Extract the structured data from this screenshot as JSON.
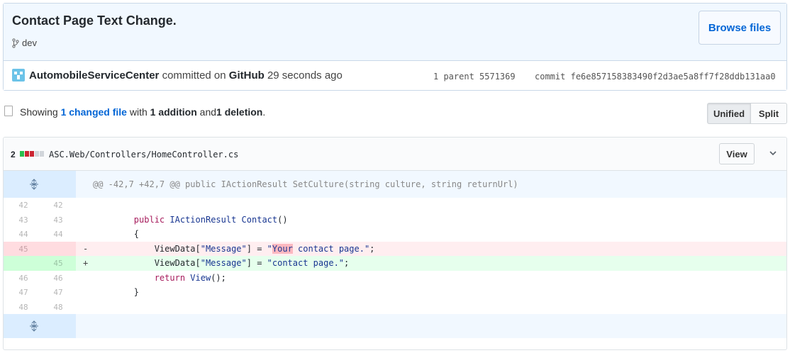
{
  "commit": {
    "title": "Contact Page Text Change.",
    "branch": "dev",
    "browse_files": "Browse files",
    "author": "AutomobileServiceCenter",
    "committed_on": "committed on",
    "platform": "GitHub",
    "time_ago": "29 seconds ago",
    "parent_label": "1 parent",
    "parent_sha": "5571369",
    "commit_label": "commit",
    "commit_sha": "fe6e857158383490f2d3ae5a8ff7f28ddb131aa0"
  },
  "summary": {
    "prefix": "Showing",
    "changed_files": "1 changed file",
    "with": "with",
    "additions": "1 addition",
    "and": "and",
    "deletions": "1 deletion",
    "suffix": ".",
    "unified_label": "Unified",
    "split_label": "Split",
    "selected_mode": "Unified"
  },
  "file": {
    "changes": "2",
    "path": "ASC.Web/Controllers/HomeController.cs",
    "view_label": "View",
    "stat_colors": [
      "#2cbe4e",
      "#cb2431",
      "#cb2431",
      "#d1d5da",
      "#d1d5da"
    ]
  },
  "diff": {
    "hunk_header": "@@ -42,7 +42,7 @@ public IActionResult SetCulture(string culture, string returnUrl)",
    "lines": [
      {
        "type": "ctx",
        "old": "42",
        "new": "42",
        "sign": "",
        "code": ""
      },
      {
        "type": "ctx",
        "old": "43",
        "new": "43",
        "sign": "",
        "code": "        public IActionResult Contact()"
      },
      {
        "type": "ctx",
        "old": "44",
        "new": "44",
        "sign": "",
        "code": "        {"
      },
      {
        "type": "del",
        "old": "45",
        "new": "",
        "sign": "-",
        "code": "            ViewData[\"Message\"] = \"Your contact page.\";"
      },
      {
        "type": "add",
        "old": "",
        "new": "45",
        "sign": "+",
        "code": "            ViewData[\"Message\"] = \"contact page.\";"
      },
      {
        "type": "ctx",
        "old": "46",
        "new": "46",
        "sign": "",
        "code": "            return View();"
      },
      {
        "type": "ctx",
        "old": "47",
        "new": "47",
        "sign": "",
        "code": "        }"
      },
      {
        "type": "ctx",
        "old": "48",
        "new": "48",
        "sign": "",
        "code": ""
      }
    ]
  }
}
